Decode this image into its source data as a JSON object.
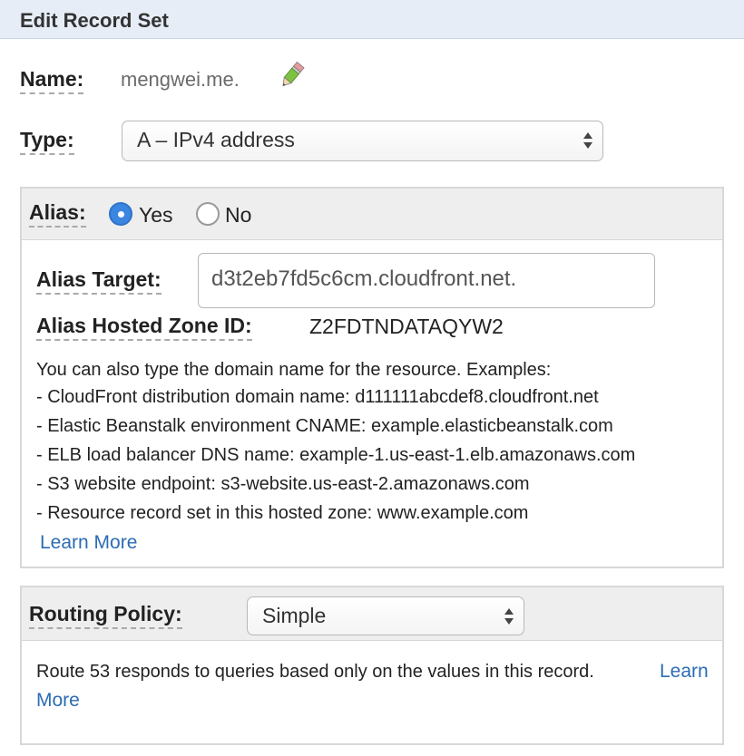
{
  "header": {
    "title": "Edit Record Set"
  },
  "name": {
    "label": "Name:",
    "value": "mengwei.me."
  },
  "type": {
    "label": "Type:",
    "selected": "A – IPv4 address"
  },
  "alias": {
    "label": "Alias:",
    "yes_label": "Yes",
    "no_label": "No",
    "selected": "Yes",
    "target_label": "Alias Target:",
    "target_value": "d3t2eb7fd5c6cm.cloudfront.net.",
    "zone_label": "Alias Hosted Zone ID:",
    "zone_value": "Z2FDTNDATAQYW2",
    "help_intro": "You can also type the domain name for the resource. Examples:",
    "examples": [
      "-  CloudFront distribution domain name: d111111abcdef8.cloudfront.net",
      "-  Elastic Beanstalk environment CNAME: example.elasticbeanstalk.com",
      "-  ELB load balancer DNS name: example-1.us-east-1.elb.amazonaws.com",
      "-  S3 website endpoint: s3-website.us-east-2.amazonaws.com",
      "-  Resource record set in this hosted zone: www.example.com"
    ],
    "learn_more": "Learn More"
  },
  "routing": {
    "label": "Routing Policy:",
    "selected": "Simple",
    "description": "Route 53 responds to queries based only on the values in this record.",
    "learn_more_1": "Learn",
    "learn_more_2": "More"
  },
  "colors": {
    "accent": "#3b86e0",
    "link": "#2b6cb3",
    "header_bg": "#e6edf7"
  }
}
